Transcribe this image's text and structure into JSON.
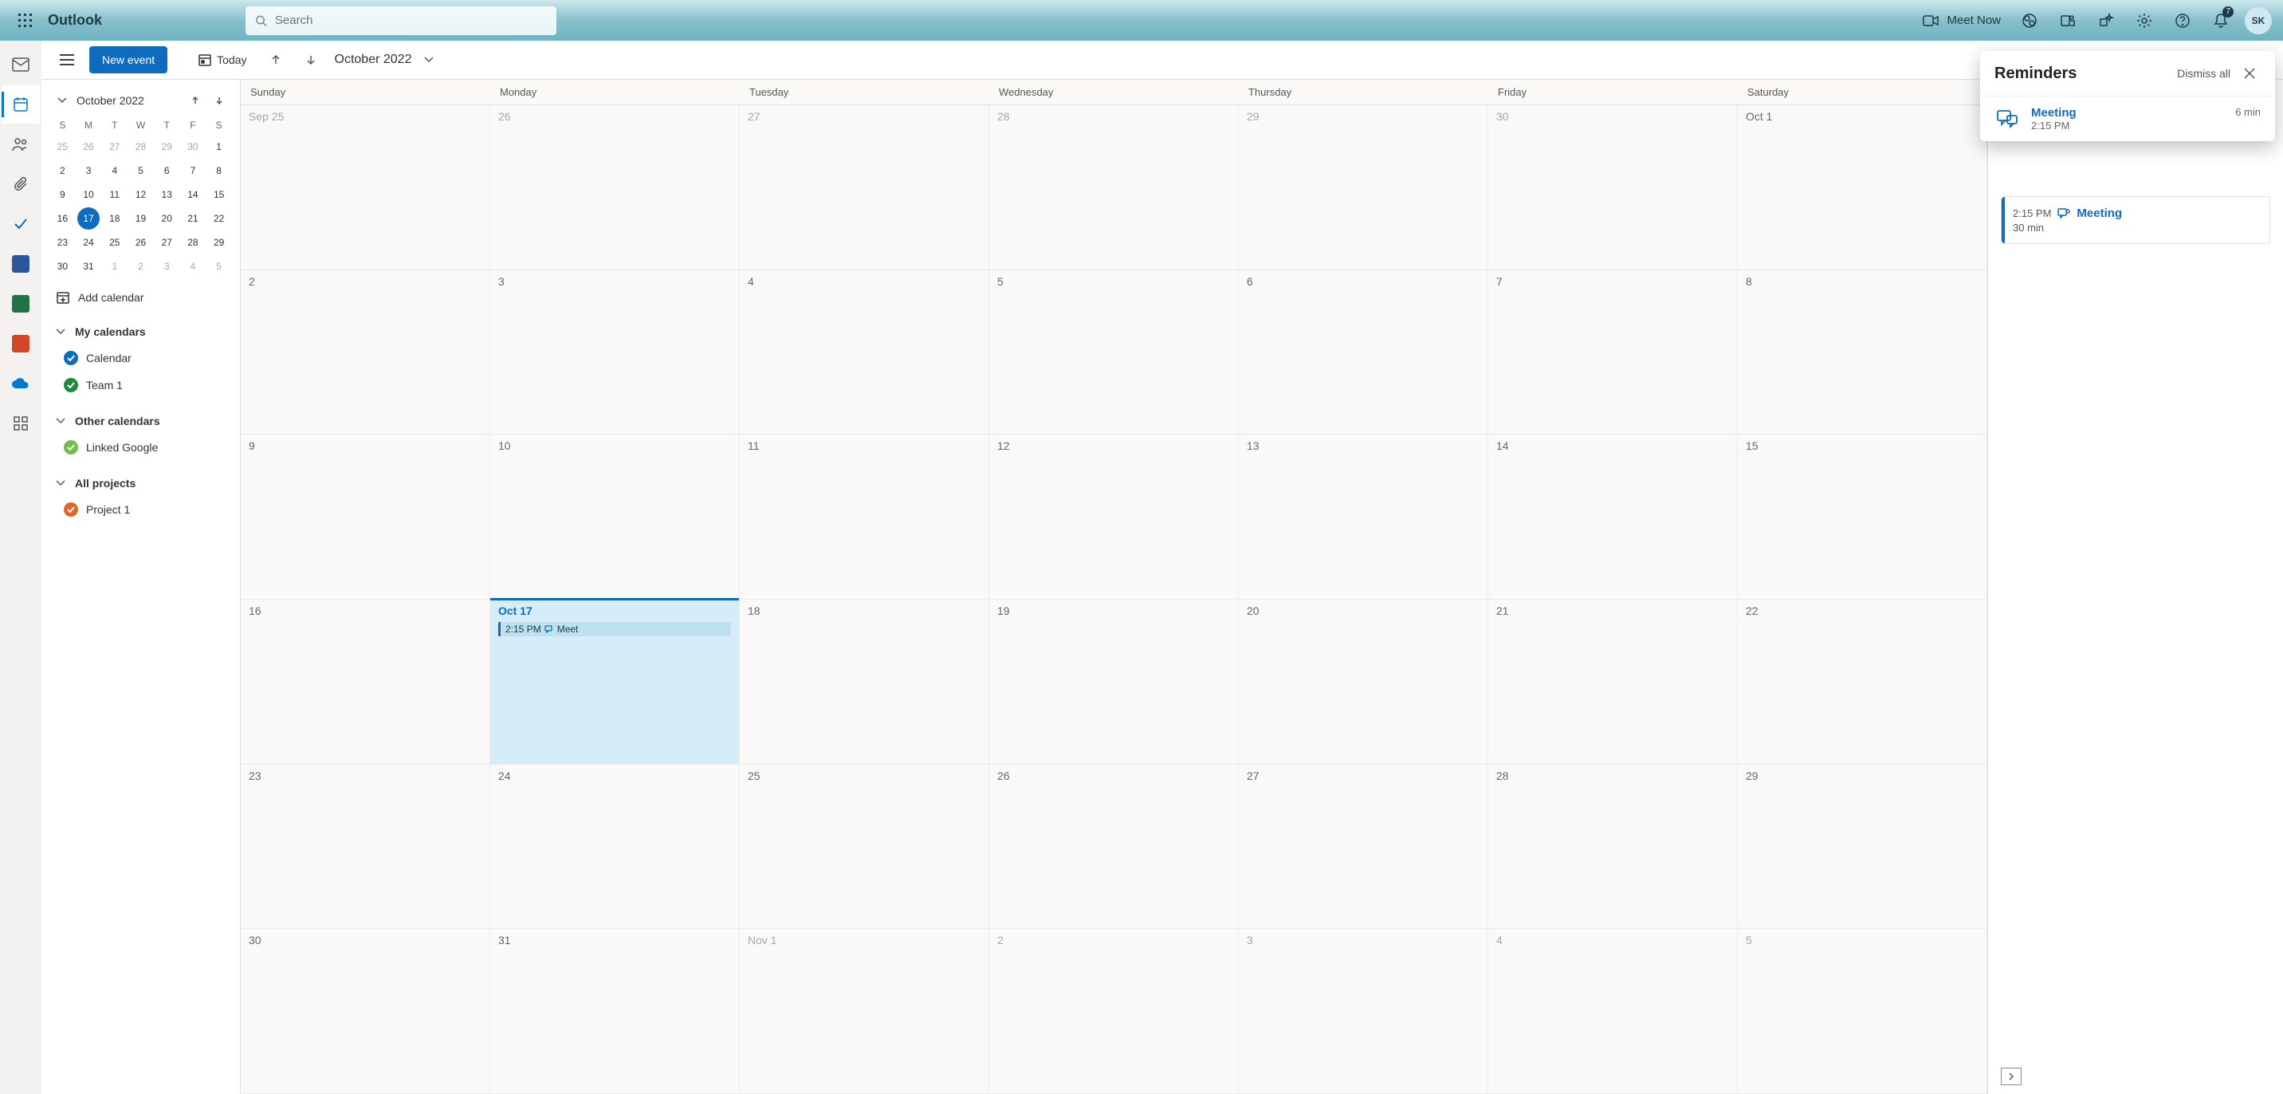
{
  "header": {
    "brand": "Outlook",
    "search_placeholder": "Search",
    "meet_now": "Meet Now",
    "notif_badge": "7",
    "avatar_initials": "SK"
  },
  "cmdbar": {
    "new_event": "New event",
    "today": "Today",
    "month_label": "October 2022"
  },
  "mini_calendar": {
    "title": "October 2022",
    "dow": [
      "S",
      "M",
      "T",
      "W",
      "T",
      "F",
      "S"
    ],
    "weeks": [
      [
        {
          "n": "25",
          "m": true
        },
        {
          "n": "26",
          "m": true
        },
        {
          "n": "27",
          "m": true
        },
        {
          "n": "28",
          "m": true
        },
        {
          "n": "29",
          "m": true
        },
        {
          "n": "30",
          "m": true
        },
        {
          "n": "1"
        }
      ],
      [
        {
          "n": "2"
        },
        {
          "n": "3"
        },
        {
          "n": "4"
        },
        {
          "n": "5"
        },
        {
          "n": "6"
        },
        {
          "n": "7"
        },
        {
          "n": "8"
        }
      ],
      [
        {
          "n": "9"
        },
        {
          "n": "10"
        },
        {
          "n": "11"
        },
        {
          "n": "12"
        },
        {
          "n": "13"
        },
        {
          "n": "14"
        },
        {
          "n": "15"
        }
      ],
      [
        {
          "n": "16"
        },
        {
          "n": "17",
          "today": true
        },
        {
          "n": "18"
        },
        {
          "n": "19"
        },
        {
          "n": "20"
        },
        {
          "n": "21"
        },
        {
          "n": "22"
        }
      ],
      [
        {
          "n": "23"
        },
        {
          "n": "24"
        },
        {
          "n": "25"
        },
        {
          "n": "26"
        },
        {
          "n": "27"
        },
        {
          "n": "28"
        },
        {
          "n": "29"
        }
      ],
      [
        {
          "n": "30"
        },
        {
          "n": "31"
        },
        {
          "n": "1",
          "m": true
        },
        {
          "n": "2",
          "m": true
        },
        {
          "n": "3",
          "m": true
        },
        {
          "n": "4",
          "m": true
        },
        {
          "n": "5",
          "m": true
        }
      ]
    ]
  },
  "sidebar": {
    "add_calendar": "Add calendar",
    "groups": [
      {
        "title": "My calendars",
        "items": [
          {
            "label": "Calendar",
            "color": "#0f6cbd",
            "checked": true
          },
          {
            "label": "Team 1",
            "color": "#1f8a3b",
            "checked": true
          }
        ]
      },
      {
        "title": "Other calendars",
        "items": [
          {
            "label": "Linked Google",
            "color": "#6fbf4b",
            "checked": true
          }
        ]
      },
      {
        "title": "All projects",
        "items": [
          {
            "label": "Project 1",
            "color": "#e0662c",
            "checked": true
          }
        ]
      }
    ]
  },
  "calendar": {
    "dow": [
      "Sunday",
      "Monday",
      "Tuesday",
      "Wednesday",
      "Thursday",
      "Friday",
      "Saturday"
    ],
    "weeks": [
      [
        {
          "label": "Sep 25",
          "m": true
        },
        {
          "label": "26",
          "m": true
        },
        {
          "label": "27",
          "m": true
        },
        {
          "label": "28",
          "m": true
        },
        {
          "label": "29",
          "m": true
        },
        {
          "label": "30",
          "m": true
        },
        {
          "label": "Oct 1"
        }
      ],
      [
        {
          "label": "2"
        },
        {
          "label": "3"
        },
        {
          "label": "4"
        },
        {
          "label": "5"
        },
        {
          "label": "6"
        },
        {
          "label": "7"
        },
        {
          "label": "8"
        }
      ],
      [
        {
          "label": "9"
        },
        {
          "label": "10"
        },
        {
          "label": "11"
        },
        {
          "label": "12"
        },
        {
          "label": "13"
        },
        {
          "label": "14"
        },
        {
          "label": "15"
        }
      ],
      [
        {
          "label": "16"
        },
        {
          "label": "Oct 17",
          "today": true,
          "event": {
            "time": "2:15 PM",
            "title": "Meet"
          }
        },
        {
          "label": "18"
        },
        {
          "label": "19"
        },
        {
          "label": "20"
        },
        {
          "label": "21"
        },
        {
          "label": "22"
        }
      ],
      [
        {
          "label": "23"
        },
        {
          "label": "24"
        },
        {
          "label": "25"
        },
        {
          "label": "26"
        },
        {
          "label": "27"
        },
        {
          "label": "28"
        },
        {
          "label": "29"
        }
      ],
      [
        {
          "label": "30"
        },
        {
          "label": "31"
        },
        {
          "label": "Nov 1",
          "m": true
        },
        {
          "label": "2",
          "m": true
        },
        {
          "label": "3",
          "m": true
        },
        {
          "label": "4",
          "m": true
        },
        {
          "label": "5",
          "m": true
        }
      ]
    ]
  },
  "agenda": {
    "event": {
      "time": "2:15 PM",
      "duration": "30 min",
      "title": "Meeting"
    }
  },
  "reminders": {
    "title": "Reminders",
    "dismiss_all": "Dismiss all",
    "items": [
      {
        "title": "Meeting",
        "time": "2:15 PM",
        "due": "6 min"
      }
    ]
  },
  "rail_apps": {
    "word_color": "#2b579a",
    "excel_color": "#217346",
    "ppt_color": "#d24726",
    "onedrive_color": "#0078d4"
  }
}
